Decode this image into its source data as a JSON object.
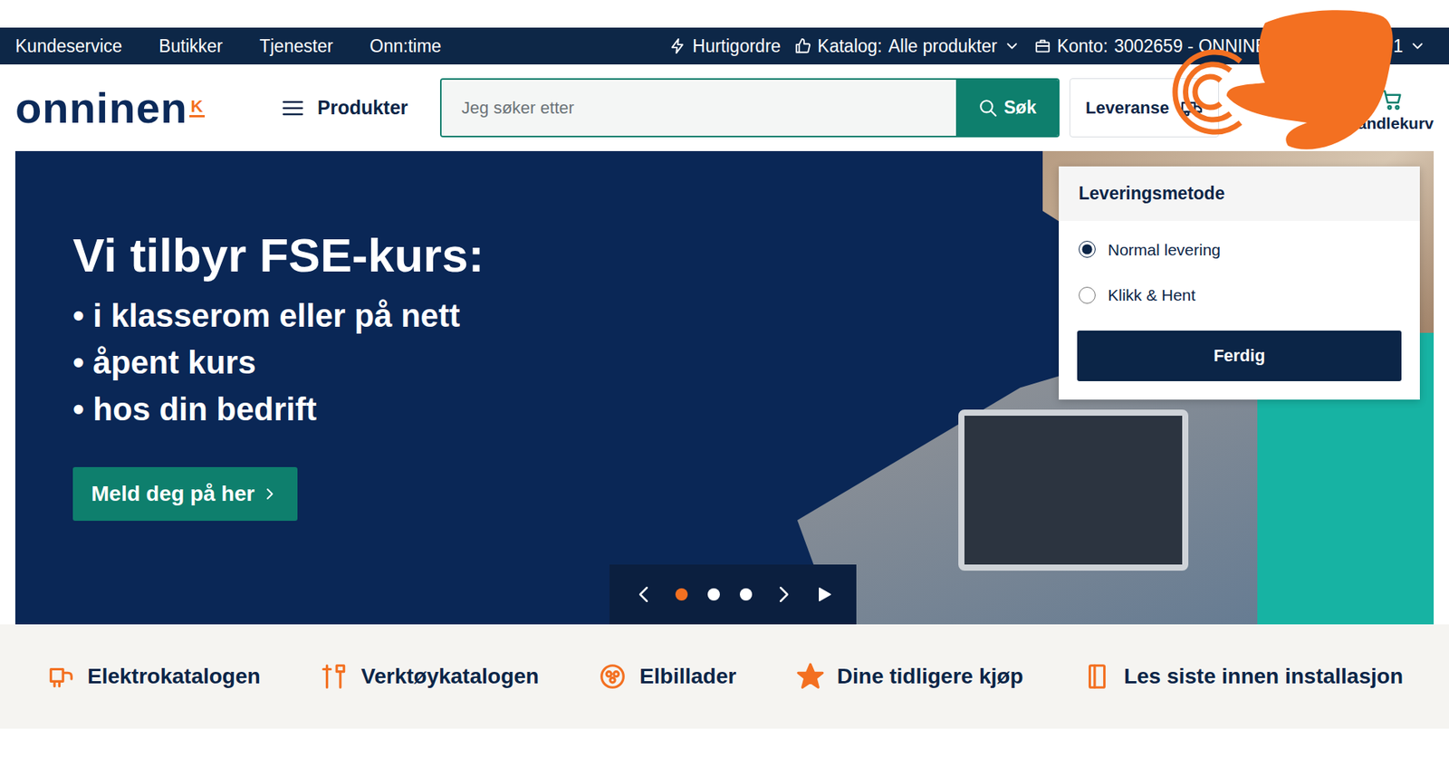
{
  "top_nav": {
    "left": [
      "Kundeservice",
      "Butikker",
      "Tjenester",
      "Onn:time"
    ],
    "quick_order": "Hurtigordre",
    "catalog_label": "Katalog:",
    "catalog_value": "Alle produkter",
    "account_label": "Konto:",
    "account_value": "3002659 - ONNINEN",
    "account_tail": "1"
  },
  "header": {
    "logo": "onninen",
    "logo_badge": "K",
    "menu": "Produkter",
    "search": {
      "placeholder": "Jeg søker etter",
      "button": "Søk"
    },
    "delivery": "Leveranse",
    "cart": "Min handlekurv"
  },
  "delivery_menu": {
    "title": "Leveringsmetode",
    "options": [
      {
        "label": "Normal levering",
        "selected": true
      },
      {
        "label": "Klikk & Hent",
        "selected": false
      }
    ],
    "button": "Ferdig"
  },
  "hero": {
    "title": "Vi tilbyr FSE-kurs:",
    "bullets": [
      "• i klasserom eller på nett",
      "• åpent kurs",
      "• hos din bedrift"
    ],
    "cta": "Meld deg på her",
    "dots": [
      {
        "selected": true
      },
      {
        "selected": false
      },
      {
        "selected": false
      }
    ]
  },
  "quick_links": [
    {
      "label": "Elektrokatalogen"
    },
    {
      "label": "Verktøykatalogen"
    },
    {
      "label": "Elbillader"
    },
    {
      "label": "Dine tidligere kjøp"
    },
    {
      "label": "Les siste innen installasjon"
    }
  ]
}
